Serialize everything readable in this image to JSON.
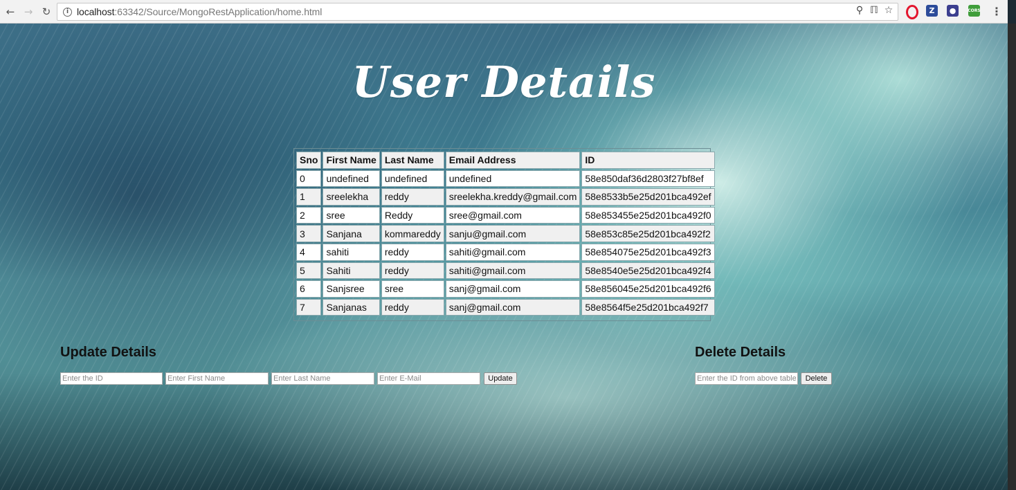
{
  "browser": {
    "url_host": "localhost",
    "url_rest": ":63342/Source/MongoRestApplication/home.html",
    "ext_z": "Z",
    "ext_cors": "CORS"
  },
  "page": {
    "title": "User Details"
  },
  "table": {
    "headers": [
      "Sno",
      "First Name",
      "Last Name",
      "Email Address",
      "ID"
    ],
    "rows": [
      [
        "0",
        "undefined",
        "undefined",
        "undefined",
        "58e850daf36d2803f27bf8ef"
      ],
      [
        "1",
        "sreelekha",
        "reddy",
        "sreelekha.kreddy@gmail.com",
        "58e8533b5e25d201bca492ef"
      ],
      [
        "2",
        "sree",
        "Reddy",
        "sree@gmail.com",
        "58e853455e25d201bca492f0"
      ],
      [
        "3",
        "Sanjana",
        "kommareddy",
        "sanju@gmail.com",
        "58e853c85e25d201bca492f2"
      ],
      [
        "4",
        "sahiti",
        "reddy",
        "sahiti@gmail.com",
        "58e854075e25d201bca492f3"
      ],
      [
        "5",
        "Sahiti",
        "reddy",
        "sahiti@gmail.com",
        "58e8540e5e25d201bca492f4"
      ],
      [
        "6",
        "Sanjsree",
        "sree",
        "sanj@gmail.com",
        "58e856045e25d201bca492f6"
      ],
      [
        "7",
        "Sanjanas",
        "reddy",
        "sanj@gmail.com",
        "58e8564f5e25d201bca492f7"
      ]
    ]
  },
  "update": {
    "title": "Update Details",
    "id_placeholder": "Enter the ID",
    "first_placeholder": "Enter First Name",
    "last_placeholder": "Enter Last Name",
    "email_placeholder": "Enter E-Mail",
    "button_label": "Update"
  },
  "delete": {
    "title": "Delete Details",
    "id_placeholder": "Enter the ID from above table",
    "button_label": "Delete"
  },
  "colors": {
    "title": "#ffffff",
    "table_header_bg": "#f0f0f0",
    "table_odd_bg": "#ffffff",
    "table_even_bg": "#f0f0f0"
  },
  "icons": [
    "back-arrow-icon",
    "forward-arrow-icon",
    "reload-icon",
    "info-icon",
    "zoom-icon",
    "key-icon",
    "star-icon",
    "opera-icon",
    "z-extension-icon",
    "mask-extension-icon",
    "cors-extension-icon",
    "menu-dots-icon"
  ]
}
